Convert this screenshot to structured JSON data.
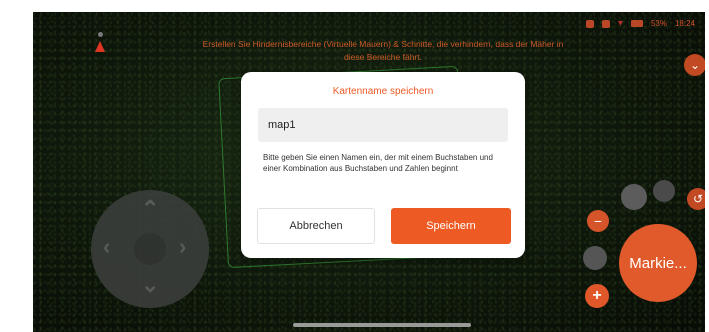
{
  "status_bar": {
    "battery_text": "53%",
    "time": "18:24"
  },
  "hint_text": "Erstellen Sie Hindernisbereiche (Virtuelle Mauern) & Schnitte, die verhindern, dass der Mäher in diese Bereiche fährt.",
  "dialog": {
    "title": "Kartenname speichern",
    "input_value": "map1",
    "help_text": "Bitte geben Sie einen Namen ein, der mit einem Buchstaben und einer Kombination aus Buchstaben und Zahlen beginnt",
    "cancel_label": "Abbrechen",
    "save_label": "Speichern"
  },
  "controls": {
    "marker_label": "Markie...",
    "minus_label": "−",
    "plus_label": "+"
  },
  "colors": {
    "accent": "#ee5a24",
    "map_background": "#0e170b",
    "map_outline": "#2e7a2e"
  }
}
